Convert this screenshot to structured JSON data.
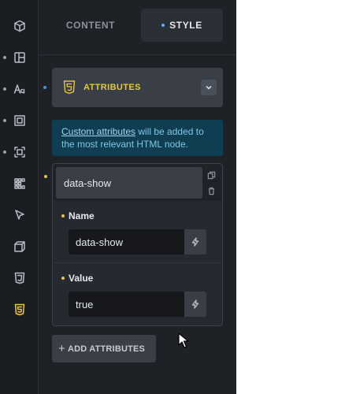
{
  "tabs": {
    "content_label": "CONTENT",
    "style_label": "STYLE"
  },
  "section": {
    "title": "ATTRIBUTES"
  },
  "info": {
    "link_text": "Custom attributes",
    "text_rest": " will be added to the most relevant HTML node."
  },
  "attribute_item": {
    "title": "data-show",
    "name_label": "Name",
    "name_value": "data-show",
    "value_label": "Value",
    "value_value": "true"
  },
  "add_button": {
    "label": "ADD ATTRIBUTES"
  },
  "rail": {
    "icons": [
      "cube-icon",
      "layout-icon",
      "typography-icon",
      "spacing-icon",
      "border-icon",
      "grid-icon",
      "cursor-icon",
      "transform-icon",
      "css3-icon",
      "html5-icon"
    ],
    "active": "html5-icon"
  },
  "colors": {
    "accent": "#e8c547",
    "info_bg": "#0f3d52",
    "info_text": "#7fc7e6",
    "panel_bg": "#1e2126"
  }
}
